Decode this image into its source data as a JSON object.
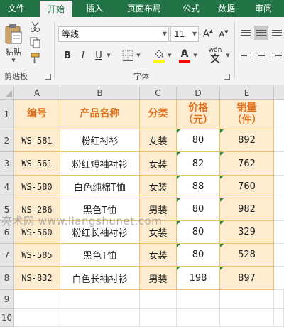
{
  "tabs": [
    {
      "label": "文件"
    },
    {
      "label": "开始"
    },
    {
      "label": "插入"
    },
    {
      "label": "页面布局"
    },
    {
      "label": "公式"
    },
    {
      "label": "数据"
    },
    {
      "label": "审阅"
    }
  ],
  "ribbon": {
    "clipboard": {
      "paste_label": "粘贴",
      "group_label": "剪贴板"
    },
    "font": {
      "font_name": "等线",
      "font_size": "11",
      "group_label": "字体",
      "pinyin_label": "wén",
      "fill_color": "#ffff00",
      "font_color": "#ff0000"
    }
  },
  "columns": [
    "A",
    "B",
    "C",
    "D",
    "E"
  ],
  "rows": [
    "1",
    "2",
    "3",
    "4",
    "5",
    "6",
    "7",
    "8",
    "9",
    "10"
  ],
  "table": {
    "headers": [
      "编号",
      "产品名称",
      "分类",
      "价格\n（元）",
      "销量\n（件）"
    ],
    "rows": [
      [
        "WS-581",
        "粉红衬衫",
        "女装",
        "80",
        "892"
      ],
      [
        "WS-561",
        "粉红短袖衬衫",
        "女装",
        "82",
        "762"
      ],
      [
        "WS-580",
        "白色纯棉T恤",
        "女装",
        "88",
        "760"
      ],
      [
        "NS-286",
        "黑色T恤",
        "男装",
        "80",
        "982"
      ],
      [
        "WS-560",
        "粉红长袖衬衫",
        "女装",
        "80",
        "329"
      ],
      [
        "WS-585",
        "黑色T恤",
        "女装",
        "80",
        "528"
      ],
      [
        "NS-832",
        "白色长袖衬衫",
        "男装",
        "198",
        "897"
      ]
    ]
  },
  "watermark": "亮术网 www.liangshunet.com",
  "colors": {
    "tabbar": "#217346",
    "header_text": "#e0701e",
    "cell_fill": "#fdeccf",
    "cell_border": "#f2c06a"
  }
}
